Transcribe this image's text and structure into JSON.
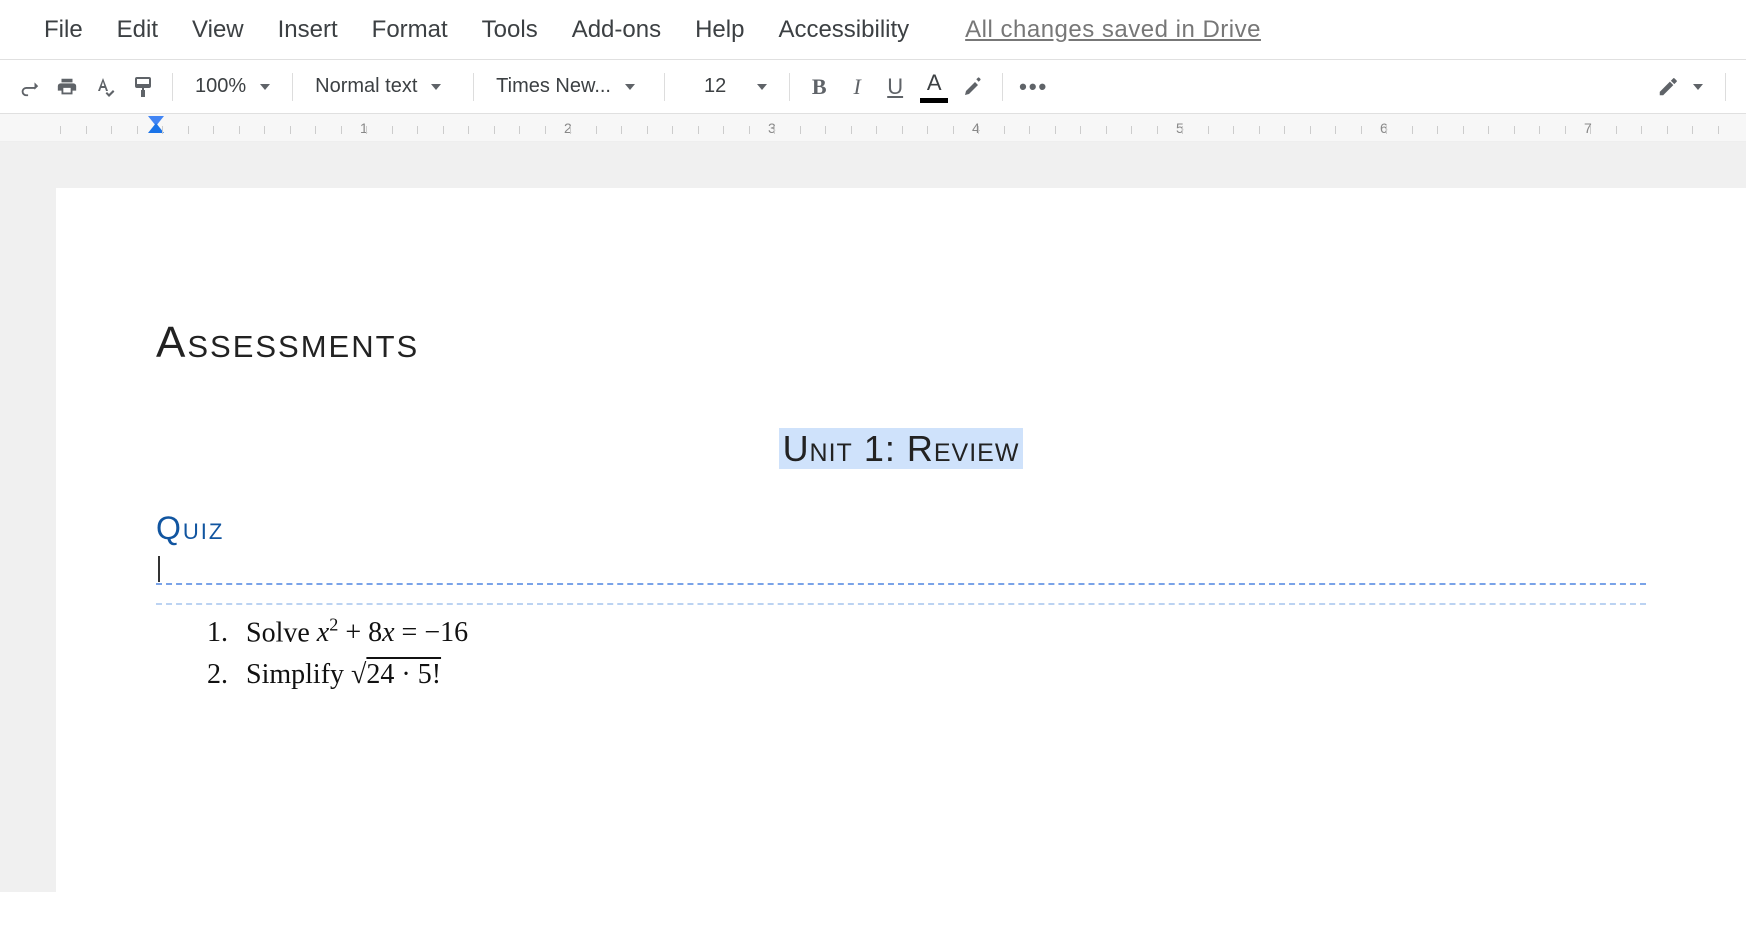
{
  "menu": {
    "file": "File",
    "edit": "Edit",
    "view": "View",
    "insert": "Insert",
    "format": "Format",
    "tools": "Tools",
    "addons": "Add-ons",
    "help": "Help",
    "accessibility": "Accessibility",
    "save_status": "All changes saved in Drive"
  },
  "toolbar": {
    "zoom": "100%",
    "style": "Normal text",
    "font": "Times New...",
    "font_size": "12",
    "bold_glyph": "B",
    "italic_glyph": "I",
    "underline_glyph": "U",
    "text_color_glyph": "A",
    "more": "•••"
  },
  "ruler": {
    "ticks": [
      "1",
      "2",
      "3",
      "4",
      "5",
      "6",
      "7"
    ]
  },
  "doc": {
    "title": "Assessments",
    "section_title": "Unit 1: Review",
    "sub_title": "Quiz",
    "q1_num": "1.",
    "q1_label": "Solve ",
    "q1_math_html": "x² + 8x = −16",
    "q2_num": "2.",
    "q2_label": "Simplify ",
    "q2_math_html": "√24 · 5!"
  }
}
